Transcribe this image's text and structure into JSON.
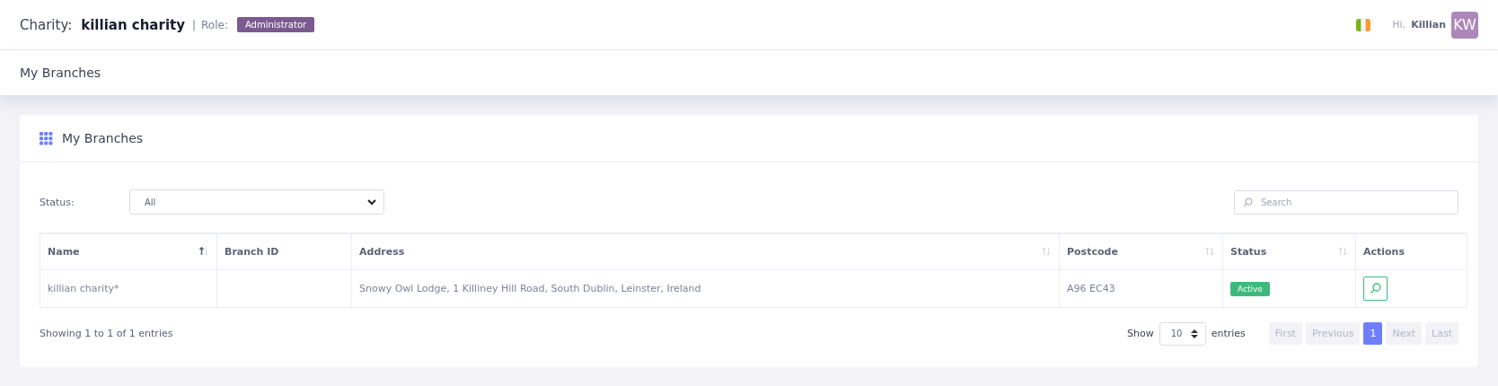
{
  "header": {
    "charity_label": "Charity:",
    "charity_name": "killian charity",
    "separator": "|",
    "role_label": "Role:",
    "role": "Administrator",
    "greeting": "Hi,",
    "user_name": "Killian",
    "avatar_initials": "KW"
  },
  "breadcrumb": {
    "title": "My Branches"
  },
  "card": {
    "title": "My Branches",
    "filter": {
      "label": "Status:",
      "value": "All"
    },
    "search": {
      "placeholder": "Search"
    },
    "table": {
      "columns": [
        {
          "label": "Name",
          "sortable": true,
          "sorted": true
        },
        {
          "label": "Branch ID",
          "sortable": false
        },
        {
          "label": "Address",
          "sortable": true,
          "sorted": false
        },
        {
          "label": "Postcode",
          "sortable": true,
          "sorted": false
        },
        {
          "label": "Status",
          "sortable": true,
          "sorted": false
        },
        {
          "label": "Actions",
          "sortable": false
        }
      ],
      "rows": [
        {
          "name": "killian charity*",
          "address": "Snowy Owl Lodge, 1 Killiney Hill Road, South Dublin, Leinster, Ireland",
          "postcode": "A96 EC43",
          "status": "Active"
        }
      ]
    },
    "info": "Showing 1 to 1 of 1 entries",
    "length": {
      "show": "Show",
      "value": "10",
      "entries": "entries"
    },
    "pagination": [
      {
        "label": "First",
        "disabled": true,
        "selected": false
      },
      {
        "label": "Previous",
        "disabled": true,
        "selected": false
      },
      {
        "label": "1",
        "disabled": false,
        "selected": true
      },
      {
        "label": "Next",
        "disabled": true,
        "selected": false
      },
      {
        "label": "Last",
        "disabled": true,
        "selected": false
      }
    ]
  }
}
